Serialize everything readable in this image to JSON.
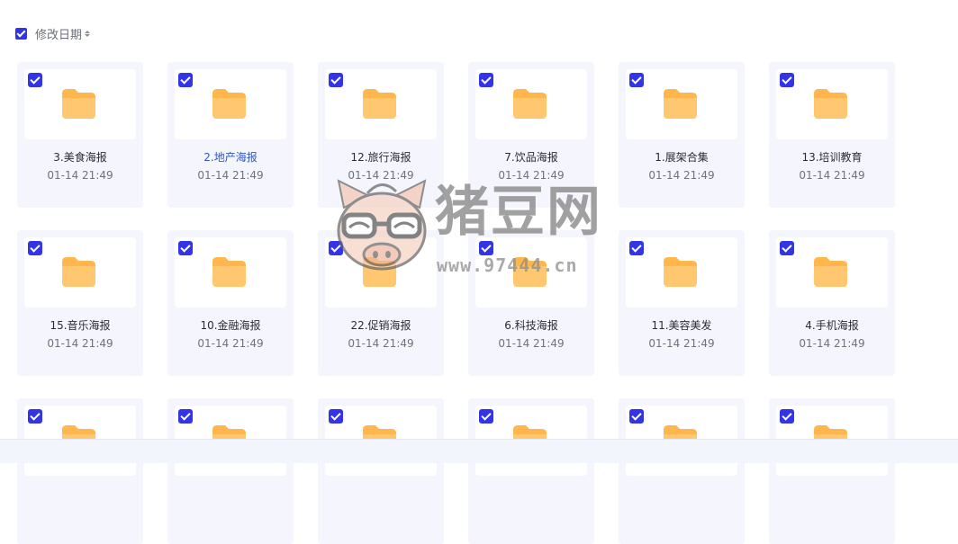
{
  "sort": {
    "label": "修改日期"
  },
  "folders": [
    {
      "name": "3.美食海报",
      "date": "01-14 21:49"
    },
    {
      "name": "2.地产海报",
      "date": "01-14 21:49"
    },
    {
      "name": "12.旅行海报",
      "date": "01-14 21:49"
    },
    {
      "name": "7.饮品海报",
      "date": "01-14 21:49"
    },
    {
      "name": "1.展架合集",
      "date": "01-14 21:49"
    },
    {
      "name": "13.培训教育",
      "date": "01-14 21:49"
    },
    {
      "name": "15.音乐海报",
      "date": "01-14 21:49"
    },
    {
      "name": "10.金融海报",
      "date": "01-14 21:49"
    },
    {
      "name": "22.促销海报",
      "date": "01-14 21:49"
    },
    {
      "name": "6.科技海报",
      "date": "01-14 21:49"
    },
    {
      "name": "11.美容美发",
      "date": "01-14 21:49"
    },
    {
      "name": "4.手机海报",
      "date": "01-14 21:49"
    }
  ],
  "colors": {
    "accent": "#3334e8",
    "folder": "#ffb74d",
    "highlight_text": "#2b56d6"
  },
  "watermark": {
    "title": "猪豆网",
    "url": "www.97444.cn"
  }
}
